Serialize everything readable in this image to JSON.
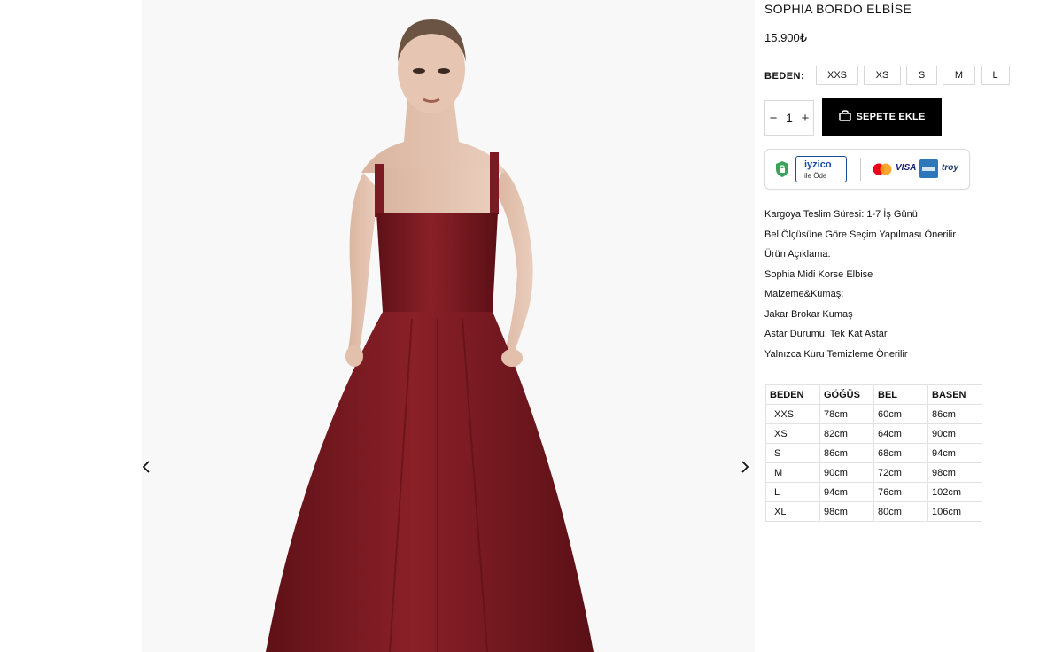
{
  "product": {
    "title": "SOPHIA BORDO ELBİSE",
    "price": "15.900₺",
    "size_label": "BEDEN:",
    "sizes": [
      "XXS",
      "XS",
      "S",
      "M",
      "L"
    ],
    "quantity": "1",
    "qty_minus": "−",
    "qty_plus": "+",
    "add_to_cart": "SEPETE EKLE"
  },
  "payment": {
    "iyzico_line1": "iyzico",
    "iyzico_line2": "ile Öde",
    "visa": "VISA",
    "troy": "troy"
  },
  "description": [
    "Kargoya Teslim Süresi: 1-7 İş Günü",
    "Bel Ölçüsüne Göre Seçim Yapılması Önerilir",
    "Ürün Açıklama:",
    "Sophia Midi Korse Elbise",
    "Malzeme&Kumaş:",
    "Jakar Brokar Kumaş",
    "Astar Durumu: Tek Kat Astar",
    "Yalnızca Kuru Temizleme Önerilir"
  ],
  "size_table": {
    "headers": [
      "BEDEN",
      "GÖĞÜS",
      "BEL",
      "BASEN"
    ],
    "rows": [
      [
        "XXS",
        "78cm",
        "60cm",
        "86cm"
      ],
      [
        "XS",
        "82cm",
        "64cm",
        "90cm"
      ],
      [
        "S",
        "86cm",
        "68cm",
        "94cm"
      ],
      [
        "M",
        "90cm",
        "72cm",
        "98cm"
      ],
      [
        "L",
        "94cm",
        "76cm",
        "102cm"
      ],
      [
        "XL",
        "98cm",
        "80cm",
        "106cm"
      ]
    ]
  },
  "colors": {
    "dress": "#7a1a22",
    "cart_button": "#000000",
    "iyzico_blue": "#1a4b9b"
  }
}
